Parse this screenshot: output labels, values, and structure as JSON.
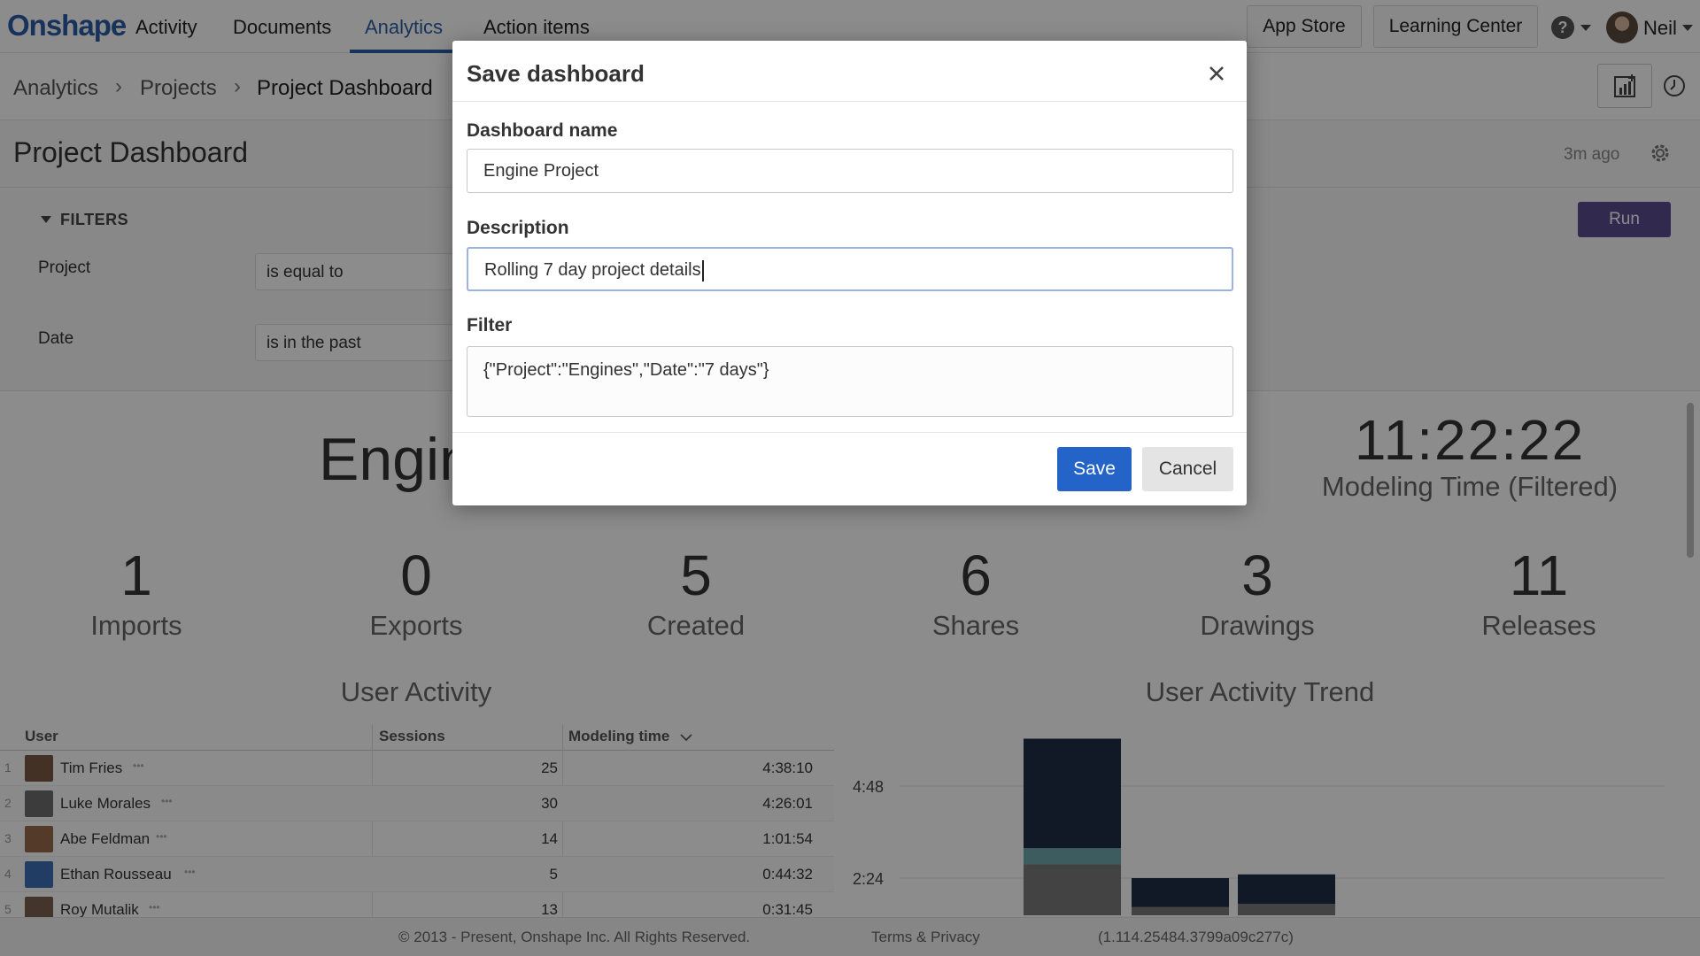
{
  "nav": {
    "logo": "Onshape",
    "links": [
      "Activity",
      "Documents",
      "Analytics",
      "Action items"
    ],
    "app_store": "App Store",
    "learning_center": "Learning Center",
    "user_name": "Neil"
  },
  "breadcrumb": [
    "Analytics",
    "Projects",
    "Project Dashboard"
  ],
  "page": {
    "title": "Project Dashboard",
    "updated": "3m ago"
  },
  "filters": {
    "title": "FILTERS",
    "run_label": "Run",
    "rows": [
      {
        "label": "Project",
        "operator": "is equal to"
      },
      {
        "label": "Date",
        "operator": "is in the past"
      }
    ]
  },
  "dashboard": {
    "project_partial": "Engin",
    "modeling_time": "11:22:22",
    "modeling_time_label": "Modeling Time (Filtered)",
    "stats": [
      {
        "value": "1",
        "label": "Imports"
      },
      {
        "value": "0",
        "label": "Exports"
      },
      {
        "value": "5",
        "label": "Created"
      },
      {
        "value": "6",
        "label": "Shares"
      },
      {
        "value": "3",
        "label": "Drawings"
      },
      {
        "value": "11",
        "label": "Releases"
      }
    ],
    "user_activity_title": "User Activity",
    "trend_title": "User Activity Trend"
  },
  "table": {
    "columns": [
      "User",
      "Sessions",
      "Modeling time"
    ],
    "rows": [
      {
        "num": "1",
        "name": "Tim Fries",
        "sessions": "25",
        "time": "4:38:10",
        "avatar": "#7a5a44"
      },
      {
        "num": "2",
        "name": "Luke Morales",
        "sessions": "30",
        "time": "4:26:01",
        "avatar": "#6e6e6e"
      },
      {
        "num": "3",
        "name": "Abe Feldman",
        "sessions": "14",
        "time": "1:01:54",
        "avatar": "#9a6a4c"
      },
      {
        "num": "4",
        "name": "Ethan Rousseau",
        "sessions": "5",
        "time": "0:44:32",
        "avatar": "#3f6fb5"
      },
      {
        "num": "5",
        "name": "Roy Mutalik",
        "sessions": "13",
        "time": "0:31:45",
        "avatar": "#7d6250"
      }
    ]
  },
  "chart_data": {
    "type": "bar",
    "title": "User Activity Trend",
    "y_ticks": [
      "4:48",
      "2:24"
    ],
    "bars": [
      {
        "dark": 0.62,
        "teal": 0.09,
        "gray": 0.29,
        "total": 0.95
      },
      {
        "dark": 0.78,
        "teal": 0.0,
        "gray": 0.22,
        "total": 0.2
      },
      {
        "dark": 0.72,
        "teal": 0.0,
        "gray": 0.28,
        "total": 0.22
      }
    ],
    "colors": {
      "dark": "#1e2f44",
      "teal": "#6fa8b0",
      "gray": "#7a7a7a"
    }
  },
  "footer": {
    "copyright": "© 2013 - Present, Onshape Inc. All Rights Reserved.",
    "terms": "Terms & Privacy",
    "version": "(1.114.25484.3799a09c277c)"
  },
  "modal": {
    "title": "Save dashboard",
    "name_label": "Dashboard name",
    "name_value": "Engine Project",
    "description_label": "Description",
    "description_value": "Rolling 7 day project details",
    "filter_label": "Filter",
    "filter_value": "{\"Project\":\"Engines\",\"Date\":\"7 days\"}",
    "save_label": "Save",
    "cancel_label": "Cancel"
  }
}
